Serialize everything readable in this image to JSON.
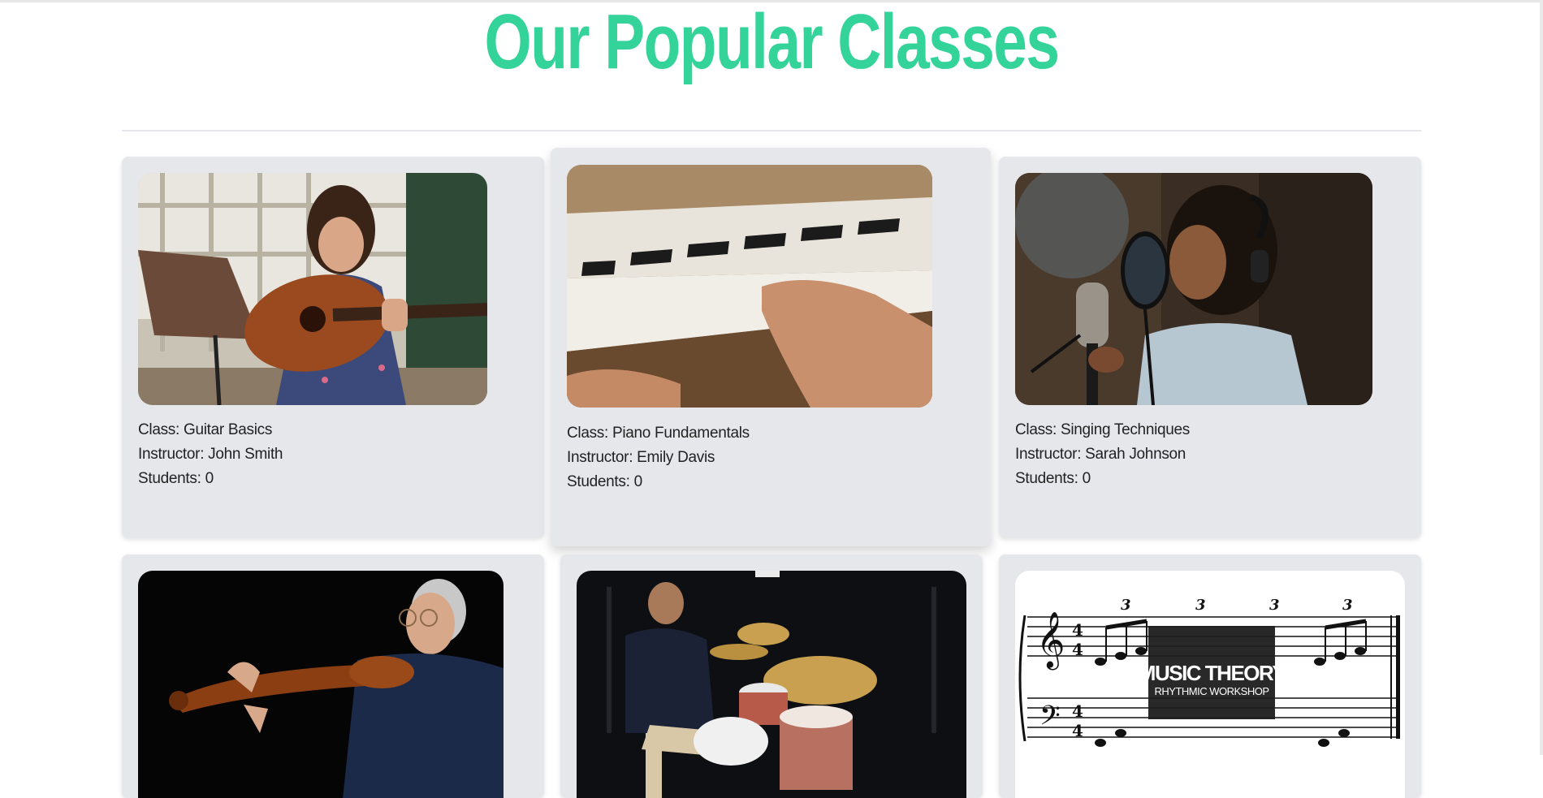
{
  "page": {
    "title": "Our Popular Classes",
    "accent_color": "#34d399",
    "card_bg": "#e5e7eb"
  },
  "labels": {
    "class_prefix": "Class: ",
    "instructor_prefix": "Instructor: ",
    "students_prefix": "Students: "
  },
  "classes": [
    {
      "class": "Guitar Basics",
      "instructor": "John Smith",
      "students": "0",
      "image": "girl-playing-guitar-photo"
    },
    {
      "class": "Piano Fundamentals",
      "instructor": "Emily Davis",
      "students": "0",
      "image": "hands-on-piano-keys-photo"
    },
    {
      "class": "Singing Techniques",
      "instructor": "Sarah Johnson",
      "students": "0",
      "image": "woman-singing-into-microphone-photo"
    },
    {
      "class": "",
      "instructor": "",
      "students": "",
      "image": "man-playing-violin-photo"
    },
    {
      "class": "",
      "instructor": "",
      "students": "",
      "image": "man-playing-drums-photo"
    },
    {
      "class": "",
      "instructor": "",
      "students": "",
      "image": "music-theory-sheet-music-image"
    }
  ],
  "music_theory_banner": {
    "title": "MUSIC THEORY",
    "subtitle": "RHYTHMIC WORKSHOP",
    "triplet_mark": "3"
  }
}
